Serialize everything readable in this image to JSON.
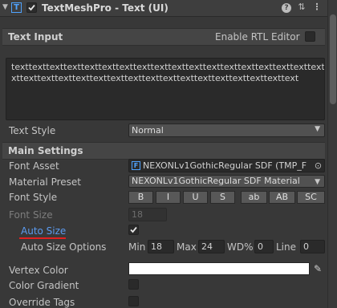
{
  "component": {
    "title": "TextMeshPro - Text (UI)",
    "icons": {
      "foldout": "triangle-down-icon",
      "component": "textmeshpro-icon",
      "help": "help-icon",
      "presets": "presets-icon",
      "menu": "kebab-menu-icon"
    }
  },
  "text_input": {
    "section_title": "Text Input",
    "rtl_label": "Enable RTL Editor",
    "rtl_checked": false,
    "line1": "texttexttexttexttexttexttexttexttexttexttexttexttexttexttexttexttexttexte",
    "line2": "xttexttexttexttexttexttexttexttexttexttexttexttexttexttexttexttext"
  },
  "text_style": {
    "label": "Text Style",
    "value": "Normal"
  },
  "main_settings": {
    "section_title": "Main Settings",
    "font_asset": {
      "label": "Font Asset",
      "value": "NEXONLv1GothicRegular SDF (TMP_F"
    },
    "material_preset": {
      "label": "Material Preset",
      "value": "NEXONLv1GothicRegular SDF Material"
    },
    "font_style": {
      "label": "Font Style",
      "buttons": [
        "B",
        "I",
        "U",
        "S",
        "ab",
        "AB",
        "SC"
      ]
    },
    "font_size": {
      "label": "Font Size",
      "value": "18"
    },
    "auto_size": {
      "label": "Auto Size",
      "checked": true
    },
    "auto_size_options": {
      "label": "Auto Size Options",
      "min_label": "Min",
      "min_value": "18",
      "max_label": "Max",
      "max_value": "24",
      "wd_label": "WD%",
      "wd_value": "0",
      "line_label": "Line",
      "line_value": "0"
    },
    "vertex_color": {
      "label": "Vertex Color",
      "color": "#ffffff"
    },
    "color_gradient": {
      "label": "Color Gradient",
      "checked": false
    },
    "override_tags": {
      "label": "Override Tags",
      "checked": false
    }
  },
  "colors": {
    "accent_link": "#5b9bf0",
    "underline": "#e02020",
    "background": "#383838"
  }
}
